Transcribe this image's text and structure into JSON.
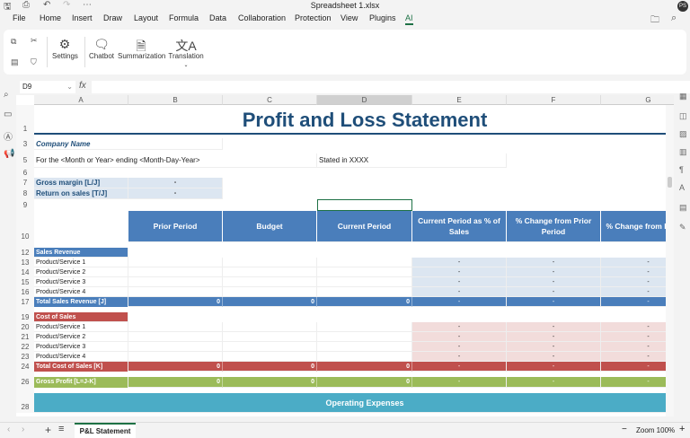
{
  "window": {
    "title": "Spreadsheet 1.xlsx",
    "avatar": "PS"
  },
  "menu": [
    "File",
    "Home",
    "Insert",
    "Draw",
    "Layout",
    "Formula",
    "Data",
    "Collaboration",
    "Protection",
    "View",
    "Plugins",
    "AI"
  ],
  "menu_active": "AI",
  "ribbon": {
    "settings": "Settings",
    "chatbot": "Chatbot",
    "summarization": "Summarization",
    "translation": "Translation"
  },
  "formula_bar": {
    "cell_ref": "D9",
    "fx": "fx",
    "value": ""
  },
  "columns": [
    "A",
    "B",
    "C",
    "D",
    "E",
    "F",
    "G"
  ],
  "selected_column": "D",
  "sheet": {
    "title": "Profit and Loss Statement",
    "company": "Company Name",
    "period": "For the <Month or Year> ending <Month-Day-Year>",
    "stated": "Stated in XXXX",
    "gross_margin": "Gross margin  [L/J]",
    "return_on_sales": "Return on sales  [T/J]",
    "dash": "-",
    "headers": [
      "Prior Period",
      "Budget",
      "Current Period",
      "Current Period as % of Sales",
      "% Change from Prior Period",
      "% Change from Budget"
    ],
    "sales_revenue": "Sales Revenue",
    "cost_of_sales": "Cost of Sales",
    "products": [
      "Product/Service 1",
      "Product/Service 2",
      "Product/Service 3",
      "Product/Service 4"
    ],
    "total_sales": "Total Sales Revenue  [J]",
    "total_cost": "Total Cost of Sales  [K]",
    "gross_profit": "Gross Profit  [L=J-K]",
    "zero": "0",
    "operating_expenses": "Operating Expenses"
  },
  "colors": {
    "blue": "#4a7ebb",
    "red": "#c0504d",
    "green": "#9bbb59",
    "teal": "#4bacc6",
    "title": "#1f4e79",
    "light_blue": "#dce6f1",
    "light_red": "#f2dcdb"
  },
  "tabs": {
    "sheet": "P&L Statement",
    "zoom": "Zoom 100%"
  }
}
